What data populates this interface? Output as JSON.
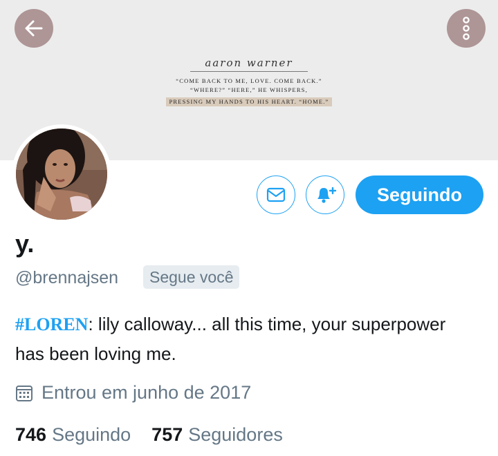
{
  "header": {
    "back_icon": "arrow-left-icon",
    "more_icon": "vertical-dots-icon",
    "banner_colors": {
      "background": "#ececec",
      "button": "#ae9596"
    },
    "banner_quote": {
      "title": "aaron warner",
      "line1": "“come back to me, love. come back.”",
      "line2": "“where?” “here,” he whispers,",
      "line3": "pressing my hands to his heart. “home.”"
    }
  },
  "profile": {
    "display_name": "y.",
    "handle": "@brennajsen",
    "follows_you_badge": "Segue você",
    "bio_hashtag": "#LOREN",
    "bio_text": ": lily calloway... all this time, your superpower has been loving me.",
    "joined": "Entrou em junho de 2017",
    "joined_icon": "calendar-icon"
  },
  "actions": {
    "message_icon": "envelope-icon",
    "notify_icon": "bell-plus-icon",
    "follow_label": "Seguindo",
    "accent_color": "#1da1f2"
  },
  "stats": {
    "following_count": "746",
    "following_label": "Seguindo",
    "followers_count": "757",
    "followers_label": "Seguidores"
  }
}
